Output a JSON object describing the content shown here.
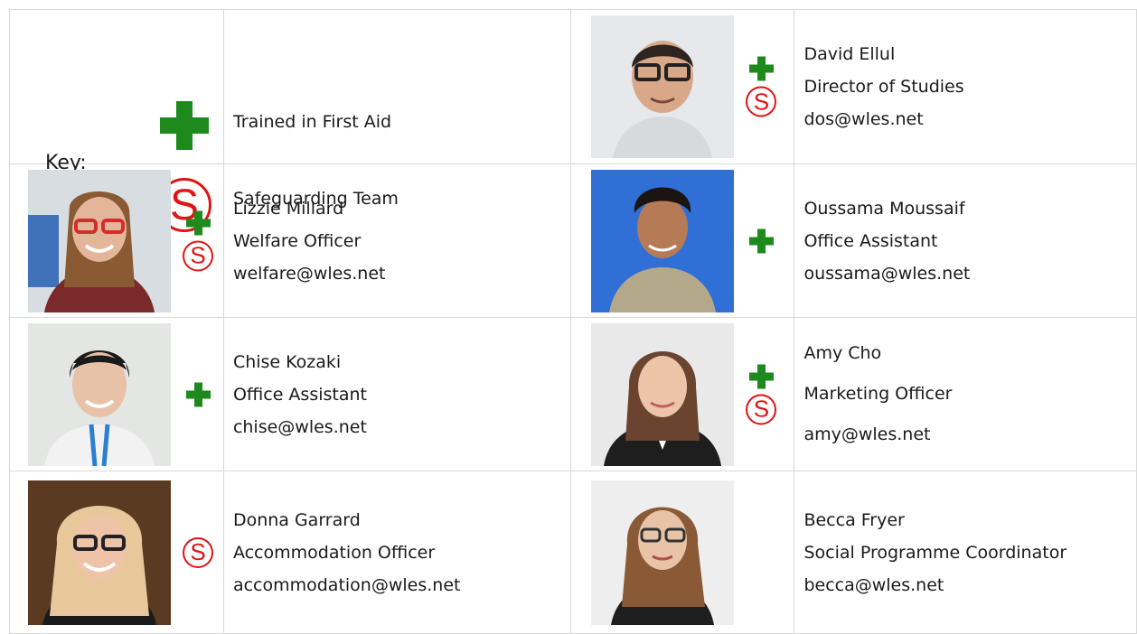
{
  "key": {
    "label": "Key:",
    "first_aid": "Trained in First Aid",
    "safeguarding": "Safeguarding Team",
    "first_aid_icon": "green-cross-icon",
    "safeguarding_icon": "red-circled-s-icon",
    "safeguarding_glyph": "S"
  },
  "colors": {
    "first_aid": "#1e8a1e",
    "safeguarding": "#e01414",
    "border": "#d9d9d9"
  },
  "staff": [
    {
      "name": "David Ellul",
      "role": "Director of Studies",
      "email": "dos@wles.net",
      "first_aid": true,
      "safeguarding": true
    },
    {
      "name": "Lizzie Millard",
      "role": "Welfare Officer",
      "email": "welfare@wles.net",
      "first_aid": true,
      "safeguarding": true
    },
    {
      "name": "Oussama Moussaif",
      "role": "Office Assistant",
      "email": "oussama@wles.net",
      "first_aid": true,
      "safeguarding": false
    },
    {
      "name": "Chise Kozaki",
      "role": "Office Assistant",
      "email": "chise@wles.net",
      "first_aid": true,
      "safeguarding": false
    },
    {
      "name": "Amy Cho",
      "role": "Marketing Officer",
      "email": "amy@wles.net",
      "first_aid": true,
      "safeguarding": true
    },
    {
      "name": "Donna Garrard",
      "role": "Accommodation Officer",
      "email": "accommodation@wles.net",
      "first_aid": false,
      "safeguarding": true
    },
    {
      "name": "Becca Fryer",
      "role": "Social Programme Coordinator",
      "email": "becca@wles.net",
      "first_aid": false,
      "safeguarding": false
    }
  ]
}
